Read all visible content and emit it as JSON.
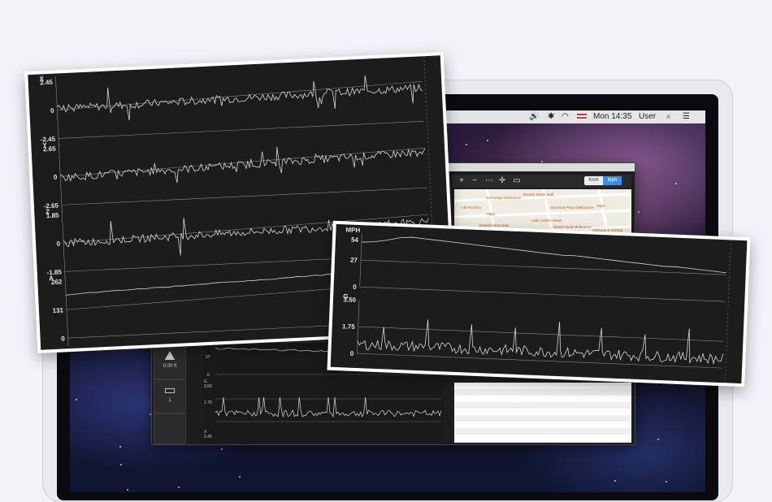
{
  "menubar": {
    "clock": "Mon 14:35",
    "user": "User",
    "icons": [
      "volume-icon",
      "bluetooth-icon",
      "wifi-icon",
      "flag-us-icon",
      "search-icon",
      "list-icon"
    ]
  },
  "app": {
    "speed_units": {
      "kmh": "Kmh",
      "mph": "Mph",
      "selected": "Mph"
    },
    "map_labels": [
      "Exchange Melbourne",
      "Bourke Street Mall",
      "+39 Pizzeria",
      "Stamford Plaza Melbourne",
      "H&M",
      "Little Collins Street",
      "Myer",
      "Grand Hyatt Melbourne",
      "Spanish Memories",
      "Melbourne Central"
    ],
    "tools": [
      {
        "icon": "terrain-icon",
        "label": "0.00 ft"
      },
      {
        "icon": "folder-icon",
        "label": "1"
      },
      {
        "icon": "blank-tool",
        "label": ""
      }
    ],
    "mini_axis": {
      "mph": "MPH",
      "mph_mid": "27",
      "mph_zero": "0",
      "g": "G",
      "g_top": "3.50",
      "g_mid": "1.75",
      "x": "X",
      "x_top": "2.45"
    }
  },
  "chart_data": [
    {
      "type": "line",
      "series": [
        {
          "name": "X",
          "ylim": [
            -2.45,
            2.45
          ],
          "ticks": [
            "2.45",
            "0",
            "-2.45"
          ],
          "trend": [
            0.1,
            0.45
          ]
        },
        {
          "name": "Y",
          "ylim": [
            -2.65,
            2.65
          ],
          "ticks": [
            "2.65",
            "0",
            "-2.65"
          ],
          "trend": [
            -0.1,
            0.7
          ]
        },
        {
          "name": "Z",
          "ylim": [
            -1.85,
            1.85
          ],
          "ticks": [
            "1.85",
            "0",
            "-1.85"
          ],
          "trend": [
            0.0,
            0.3
          ]
        },
        {
          "name": "A",
          "ylim": [
            0,
            262
          ],
          "ticks": [
            "262",
            "131",
            "0"
          ],
          "trend": [
            200,
            250
          ]
        }
      ]
    },
    {
      "type": "line",
      "series": [
        {
          "name": "MPH",
          "ylim": [
            0,
            54
          ],
          "ticks": [
            "54",
            "27",
            "0"
          ],
          "values": [
            45,
            46,
            48,
            51,
            52,
            51,
            50,
            49,
            48,
            47,
            46,
            45,
            44,
            43,
            42,
            41,
            40,
            40,
            39,
            38,
            37,
            36,
            35,
            34,
            33,
            33,
            32,
            31,
            30,
            29
          ]
        },
        {
          "name": "G",
          "ylim": [
            0,
            3.5
          ],
          "ticks": [
            "3.50",
            "1.75",
            "0"
          ],
          "baseline": 0.6,
          "peaks": [
            1.8,
            2.4,
            2.2,
            2.1,
            2.6,
            2.3,
            2.0,
            2.5
          ]
        }
      ]
    }
  ]
}
